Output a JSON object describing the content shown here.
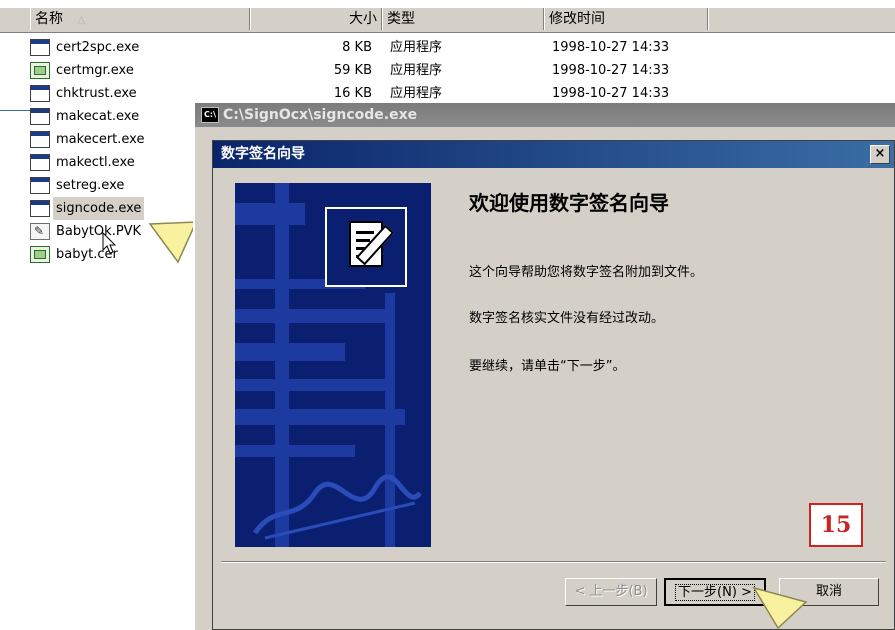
{
  "list_header": {
    "name": "名称",
    "sort_glyph": "△",
    "size": "大小",
    "type": "类型",
    "modified": "修改时间"
  },
  "files": [
    {
      "name": "cert2spc.exe",
      "icon": "exe-file-icon",
      "size": "8 KB",
      "type": "应用程序",
      "modified": "1998-10-27 14:33"
    },
    {
      "name": "certmgr.exe",
      "icon": "cert-app-icon",
      "size": "59 KB",
      "type": "应用程序",
      "modified": "1998-10-27 14:33"
    },
    {
      "name": "chktrust.exe",
      "icon": "exe-file-icon",
      "size": "16 KB",
      "type": "应用程序",
      "modified": "1998-10-27 14:33"
    },
    {
      "name": "makecat.exe",
      "icon": "exe-file-icon"
    },
    {
      "name": "makecert.exe",
      "icon": "exe-file-icon"
    },
    {
      "name": "makectl.exe",
      "icon": "exe-file-icon"
    },
    {
      "name": "setreg.exe",
      "icon": "exe-file-icon"
    },
    {
      "name": "signcode.exe",
      "icon": "exe-file-icon",
      "selected": true
    },
    {
      "name": "BabytOk.PVK",
      "icon": "pvk-file-icon"
    },
    {
      "name": "babyt.cer",
      "icon": "cer-file-icon"
    }
  ],
  "console": {
    "icon_text": "C:\\",
    "title": "C:\\SignOcx\\signcode.exe"
  },
  "wizard": {
    "title": "数字签名向导",
    "close": "×",
    "heading": "欢迎使用数字签名向导",
    "line1": "这个向导帮助您将数字签名附加到文件。",
    "line2": "数字签名核实文件没有经过改动。",
    "line3": "要继续，请单击“下一步”。",
    "step_number": "15",
    "back_button": "< 上一步(B)",
    "next_button": "下一步(N) >",
    "cancel_button": "取消"
  },
  "colors": {
    "title_active": "#0a246a",
    "banner": "#0a1f70",
    "badge": "#cc2222",
    "face": "#d4d0c8"
  }
}
